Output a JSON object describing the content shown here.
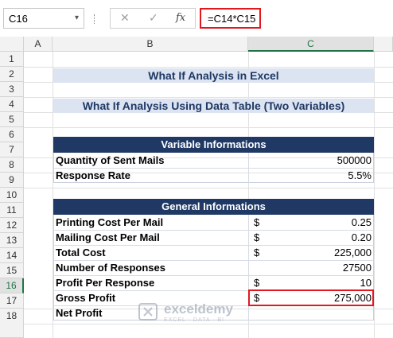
{
  "formula_bar": {
    "name_box": "C16",
    "name_box_arrow": "▾",
    "cancel_glyph": "✕",
    "enter_glyph": "✓",
    "fx_label": "fx",
    "formula": "=C14*C15"
  },
  "columns": [
    "A",
    "B",
    "C"
  ],
  "rows": [
    "1",
    "2",
    "3",
    "4",
    "5",
    "6",
    "7",
    "8",
    "9",
    "10",
    "11",
    "12",
    "13",
    "14",
    "15",
    "16",
    "17",
    "18"
  ],
  "selected_column": "C",
  "selected_row": "16",
  "sheet": {
    "title": "What If Analysis in Excel",
    "subtitle": "What If Analysis Using Data Table (Two Variables)",
    "variable_header": "Variable Informations",
    "variables": [
      {
        "label": "Quantity of Sent Mails",
        "value": "500000"
      },
      {
        "label": "Response Rate",
        "value": "5.5%"
      }
    ],
    "general_header": "General Informations",
    "general": [
      {
        "label": "Printing Cost Per Mail",
        "currency": "$",
        "value": "0.25"
      },
      {
        "label": "Mailing Cost Per Mail",
        "currency": "$",
        "value": "0.20"
      },
      {
        "label": "Total Cost",
        "currency": "$",
        "value": "225,000"
      },
      {
        "label": "Number of Responses",
        "currency": "",
        "value": "27500"
      },
      {
        "label": "Profit Per Response",
        "currency": "$",
        "value": "10"
      },
      {
        "label": "Gross Profit",
        "currency": "$",
        "value": "275,000"
      },
      {
        "label": "Net Profit",
        "currency": "",
        "value": ""
      }
    ]
  },
  "watermark": {
    "name": "exceldemy",
    "tagline": "EXCEL · DATA · BI"
  },
  "colors": {
    "header_fill": "#1f3864",
    "title_fill": "#dce3f1",
    "highlight": "#e0191f",
    "selection": "#217346"
  }
}
